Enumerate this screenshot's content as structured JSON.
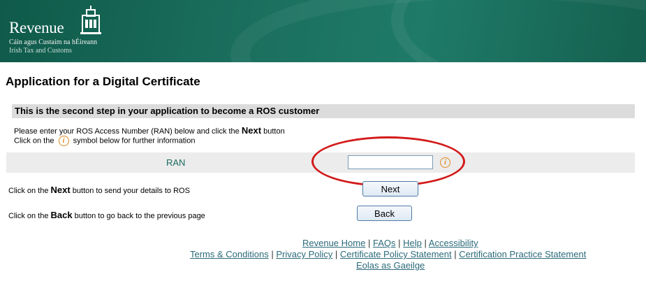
{
  "header": {
    "logo_title": "Revenue",
    "logo_sub_irish": "Cáin agus Custaim na hÉireann",
    "logo_sub_english": "Irish Tax and Customs",
    "logo_icon": "harp-building-icon"
  },
  "page": {
    "title": "Application for a Digital Certificate",
    "step_heading": "This is the second step in your application to become a ROS customer",
    "instruction_1_pre": "Please enter your ROS Access Number (RAN) below and click the ",
    "instruction_1_bold": "Next",
    "instruction_1_post": " button",
    "instruction_2_pre": "Click on the ",
    "instruction_2_post": " symbol below  for further information"
  },
  "form": {
    "ran_label": "RAN",
    "ran_value": "",
    "info_symbol": "i"
  },
  "actions": {
    "next_text_pre": "Click on the ",
    "next_text_bold": "Next",
    "next_text_post": " button to send your details to ROS",
    "next_button": "Next",
    "back_text_pre": "Click on the ",
    "back_text_bold": "Back",
    "back_text_post": " button to go back to the previous page",
    "back_button": "Back"
  },
  "footer": {
    "links_row1": [
      "Revenue Home",
      "FAQs",
      "Help",
      "Accessibility"
    ],
    "links_row2": [
      "Terms & Conditions",
      "Privacy Policy",
      "Certificate Policy Statement",
      "Certification Practice Statement"
    ],
    "links_row3": [
      "Eolas as Gaeilge"
    ],
    "separator": "|"
  },
  "colors": {
    "banner": "#1a6d5c",
    "link": "#2b6a7a",
    "highlight_ellipse": "#d31a1a",
    "info_icon": "#e08a1e"
  }
}
